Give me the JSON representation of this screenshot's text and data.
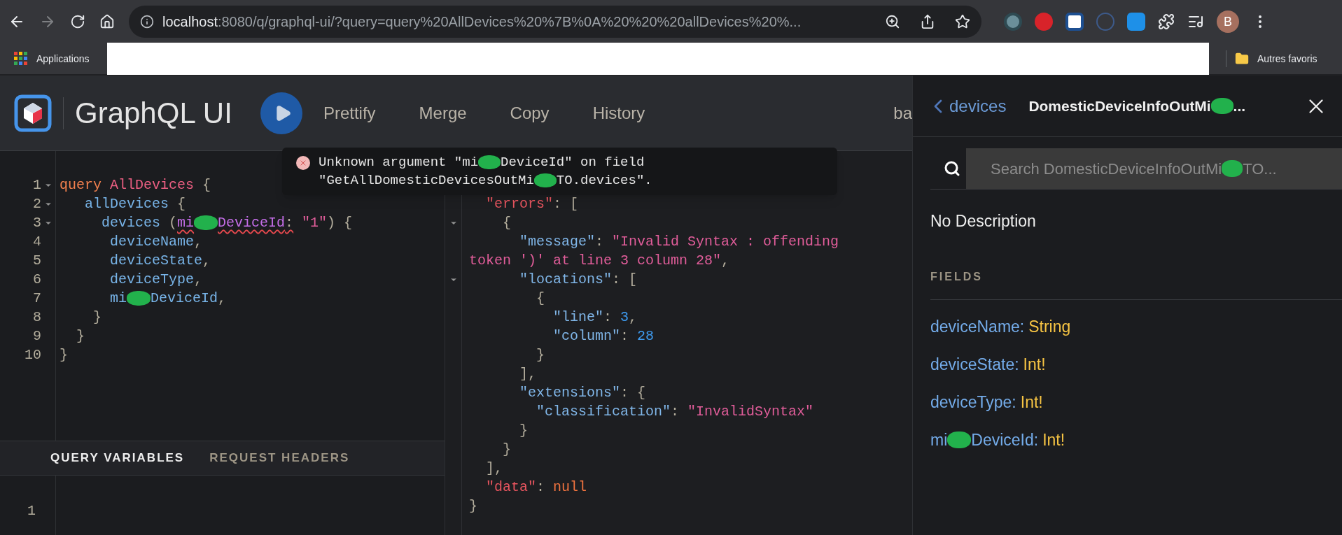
{
  "browser": {
    "url_host": "localhost",
    "url_rest": ":8080/q/graphql-ui/?query=query%20AllDevices%20%7B%0A%20%20%20allDevices%20%...",
    "profile_initial": "B",
    "bookmarks": [
      {
        "label": "Applications"
      }
    ],
    "other_bookmarks": "Autres favoris"
  },
  "app": {
    "title": "GraphQL UI",
    "toolbar": [
      "Prettify",
      "Merge",
      "Copy",
      "History"
    ],
    "toolbar_cut": "ba"
  },
  "editor": {
    "lines": [
      {
        "number": "1",
        "fold": true,
        "tokens": [
          {
            "kind": "keyword",
            "text": "query "
          },
          {
            "kind": "opname",
            "text": "AllDevices "
          },
          {
            "kind": "punct",
            "text": "{"
          }
        ]
      },
      {
        "number": "2",
        "fold": true,
        "tokens": [
          {
            "kind": "field",
            "text": "   allDevices "
          },
          {
            "kind": "punct",
            "text": "{"
          }
        ]
      },
      {
        "number": "3",
        "fold": true,
        "tokens": [
          {
            "kind": "field",
            "text": "     devices "
          },
          {
            "kind": "punct",
            "text": "("
          },
          {
            "kind": "argument",
            "text": "mi",
            "error": true
          },
          {
            "kind": "redacted"
          },
          {
            "kind": "argument",
            "text": "DeviceId",
            "error": true
          },
          {
            "kind": "punct",
            "text": ":",
            "error": true
          },
          {
            "kind": "string",
            "text": " \"1\""
          },
          {
            "kind": "punct",
            "text": ") {"
          }
        ]
      },
      {
        "number": "4",
        "fold": false,
        "tokens": [
          {
            "kind": "field",
            "text": "      deviceName"
          },
          {
            "kind": "punct",
            "text": ","
          }
        ]
      },
      {
        "number": "5",
        "fold": false,
        "tokens": [
          {
            "kind": "field",
            "text": "      deviceState"
          },
          {
            "kind": "punct",
            "text": ","
          }
        ]
      },
      {
        "number": "6",
        "fold": false,
        "tokens": [
          {
            "kind": "field",
            "text": "      deviceType"
          },
          {
            "kind": "punct",
            "text": ","
          }
        ]
      },
      {
        "number": "7",
        "fold": false,
        "tokens": [
          {
            "kind": "field",
            "text": "      mi"
          },
          {
            "kind": "redacted"
          },
          {
            "kind": "field",
            "text": "DeviceId"
          },
          {
            "kind": "punct",
            "text": ","
          }
        ]
      },
      {
        "number": "8",
        "fold": false,
        "tokens": [
          {
            "kind": "punct",
            "text": "    }"
          }
        ]
      },
      {
        "number": "9",
        "fold": false,
        "tokens": [
          {
            "kind": "punct",
            "text": "  }"
          }
        ]
      },
      {
        "number": "10",
        "fold": false,
        "tokens": [
          {
            "kind": "punct",
            "text": "}"
          }
        ]
      }
    ]
  },
  "tabs": [
    {
      "label": "QUERY VARIABLES",
      "selected": true
    },
    {
      "label": "REQUEST HEADERS",
      "selected": false
    }
  ],
  "variables": {
    "lines": [
      {
        "number": "1"
      }
    ]
  },
  "tooltip": {
    "lines": [
      [
        {
          "kind": "text",
          "text": "Unknown argument \"mi"
        },
        {
          "kind": "redacted"
        },
        {
          "kind": "text",
          "text": "DeviceId\" on field"
        }
      ],
      [
        {
          "kind": "text",
          "text": "\"GetAllDomesticDevicesOutMi"
        },
        {
          "kind": "redacted"
        },
        {
          "kind": "text",
          "text": "TO.devices\"."
        }
      ]
    ]
  },
  "result": {
    "lines": [
      {
        "fold": false,
        "tokens": [
          {
            "kind": "errkey",
            "text": "  \"errors\""
          },
          {
            "kind": "punct",
            "text": ": ["
          }
        ]
      },
      {
        "fold": true,
        "tokens": [
          {
            "kind": "punct",
            "text": "    {"
          }
        ]
      },
      {
        "fold": false,
        "tokens": [
          {
            "kind": "key",
            "text": "      \"message\""
          },
          {
            "kind": "punct",
            "text": ": "
          },
          {
            "kind": "string",
            "text": "\"Invalid Syntax : offending"
          }
        ]
      },
      {
        "fold": false,
        "tokens": [
          {
            "kind": "string",
            "text": "token ')' at line 3 column 28\""
          },
          {
            "kind": "punct",
            "text": ","
          }
        ]
      },
      {
        "fold": true,
        "tokens": [
          {
            "kind": "key",
            "text": "      \"locations\""
          },
          {
            "kind": "punct",
            "text": ": ["
          }
        ]
      },
      {
        "fold": false,
        "tokens": [
          {
            "kind": "punct",
            "text": "        {"
          }
        ]
      },
      {
        "fold": false,
        "tokens": [
          {
            "kind": "key",
            "text": "          \"line\""
          },
          {
            "kind": "punct",
            "text": ": "
          },
          {
            "kind": "number",
            "text": "3"
          },
          {
            "kind": "punct",
            "text": ","
          }
        ]
      },
      {
        "fold": false,
        "tokens": [
          {
            "kind": "key",
            "text": "          \"column\""
          },
          {
            "kind": "punct",
            "text": ": "
          },
          {
            "kind": "number",
            "text": "28"
          }
        ]
      },
      {
        "fold": false,
        "tokens": [
          {
            "kind": "punct",
            "text": "        }"
          }
        ]
      },
      {
        "fold": false,
        "tokens": [
          {
            "kind": "punct",
            "text": "      ],"
          }
        ]
      },
      {
        "fold": false,
        "tokens": [
          {
            "kind": "key",
            "text": "      \"extensions\""
          },
          {
            "kind": "punct",
            "text": ": {"
          }
        ]
      },
      {
        "fold": false,
        "tokens": [
          {
            "kind": "key",
            "text": "        \"classification\""
          },
          {
            "kind": "punct",
            "text": ": "
          },
          {
            "kind": "string",
            "text": "\"InvalidSyntax\""
          }
        ]
      },
      {
        "fold": false,
        "tokens": [
          {
            "kind": "punct",
            "text": "      }"
          }
        ]
      },
      {
        "fold": false,
        "tokens": [
          {
            "kind": "punct",
            "text": "    }"
          }
        ]
      },
      {
        "fold": false,
        "tokens": [
          {
            "kind": "punct",
            "text": "  ],"
          }
        ]
      },
      {
        "fold": false,
        "tokens": [
          {
            "kind": "errkey",
            "text": "  \"data\""
          },
          {
            "kind": "punct",
            "text": ": "
          },
          {
            "kind": "null",
            "text": "null"
          }
        ]
      },
      {
        "fold": false,
        "tokens": [
          {
            "kind": "punct",
            "text": "}"
          }
        ]
      }
    ]
  },
  "docs": {
    "back": "devices",
    "title": [
      {
        "kind": "text",
        "text": "DomesticDeviceInfoOutMi"
      },
      {
        "kind": "redacted"
      },
      {
        "kind": "text",
        "text": "..."
      }
    ],
    "placeholder": [
      {
        "kind": "text",
        "text": "Search DomesticDeviceInfoOutMi"
      },
      {
        "kind": "redacted"
      },
      {
        "kind": "text",
        "text": "TO..."
      }
    ],
    "description": "No Description",
    "fields_heading": "FIELDS",
    "fields": [
      {
        "name": [
          {
            "kind": "text",
            "text": "deviceName"
          }
        ],
        "colon": ":",
        "type": "String"
      },
      {
        "name": [
          {
            "kind": "text",
            "text": "deviceState"
          }
        ],
        "colon": ":",
        "type": "Int!"
      },
      {
        "name": [
          {
            "kind": "text",
            "text": "deviceType"
          }
        ],
        "colon": ":",
        "type": "Int!"
      },
      {
        "name": [
          {
            "kind": "text",
            "text": "mi"
          },
          {
            "kind": "redacted"
          },
          {
            "kind": "text",
            "text": "DeviceId"
          }
        ],
        "colon": ":",
        "type": "Int!"
      }
    ]
  }
}
